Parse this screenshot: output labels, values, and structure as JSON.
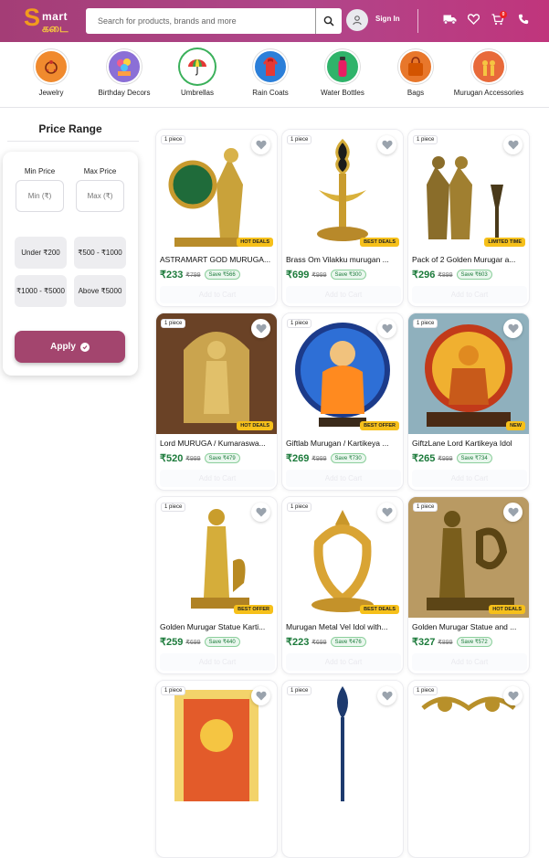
{
  "header": {
    "logo_s": "S",
    "logo_mart": "mart",
    "logo_tamil": "கடை",
    "search_placeholder": "Search for products, brands and more",
    "signin": "Sign In",
    "cart_count": "0"
  },
  "categories": [
    {
      "label": "Jewelry",
      "color": "#f08a2e"
    },
    {
      "label": "Birthday Decors",
      "color": "#8b6fd6"
    },
    {
      "label": "Umbrellas",
      "color": "#3ab05a"
    },
    {
      "label": "Rain Coats",
      "color": "#2b7fd9"
    },
    {
      "label": "Water Bottles",
      "color": "#2fb36a"
    },
    {
      "label": "Bags",
      "color": "#e8772b"
    },
    {
      "label": "Murugan Accessories",
      "color": "#e86a3a"
    }
  ],
  "filter": {
    "title": "Price Range",
    "min_label": "Min Price",
    "max_label": "Max Price",
    "min_placeholder": "Min (₹)",
    "max_placeholder": "Max (₹)",
    "ranges": [
      "Under ₹200",
      "₹500 - ₹1000",
      "₹1000 - ₹5000",
      "Above ₹5000"
    ],
    "apply": "Apply"
  },
  "products": [
    {
      "piece": "1 piece",
      "tag": "HOT DEALS",
      "name": "ASTRAMART GOD MURUGA...",
      "price": "₹233",
      "mrp": "₹799",
      "save": "Save ₹566",
      "cart": "Add to Cart",
      "bg": "#ffffff"
    },
    {
      "piece": "1 piece",
      "tag": "BEST DEALS",
      "name": "Brass Om Vilakku murugan ...",
      "price": "₹699",
      "mrp": "₹999",
      "save": "Save ₹300",
      "cart": "Add to Cart",
      "bg": "#ffffff"
    },
    {
      "piece": "1 piece",
      "tag": "LIMITED TIME",
      "name": "Pack of 2 Golden Murugar a...",
      "price": "₹296",
      "mrp": "₹899",
      "save": "Save ₹603",
      "cart": "Add to Cart",
      "bg": "#ffffff"
    },
    {
      "piece": "1 piece",
      "tag": "HOT DEALS",
      "name": "Lord MURUGA / Kumaraswa...",
      "price": "₹520",
      "mrp": "₹999",
      "save": "Save ₹479",
      "cart": "Add to Cart",
      "bg": "#6a4226"
    },
    {
      "piece": "1 piece",
      "tag": "BEST OFFER",
      "name": "Giftlab Murugan / Kartikeya ...",
      "price": "₹269",
      "mrp": "₹999",
      "save": "Save ₹730",
      "cart": "Add to Cart",
      "bg": "#ffffff"
    },
    {
      "piece": "1 piece",
      "tag": "NEW",
      "name": "GiftzLane Lord Kartikeya Idol",
      "price": "₹265",
      "mrp": "₹999",
      "save": "Save ₹734",
      "cart": "Add to Cart",
      "bg": "#8fb0bd"
    },
    {
      "piece": "1 piece",
      "tag": "BEST OFFER",
      "name": "Golden Murugar Statue Karti...",
      "price": "₹259",
      "mrp": "₹699",
      "save": "Save ₹440",
      "cart": "Add to Cart",
      "bg": "#ffffff"
    },
    {
      "piece": "1 piece",
      "tag": "BEST DEALS",
      "name": "Murugan Metal Vel Idol with...",
      "price": "₹223",
      "mrp": "₹699",
      "save": "Save ₹476",
      "cart": "Add to Cart",
      "bg": "#ffffff"
    },
    {
      "piece": "1 piece",
      "tag": "HOT DEALS",
      "name": "Golden Murugar Statue and ...",
      "price": "₹327",
      "mrp": "₹899",
      "save": "Save ₹572",
      "cart": "Add to Cart",
      "bg": "#b99a63"
    },
    {
      "piece": "1 piece",
      "tag": "",
      "name": "",
      "price": "",
      "mrp": "",
      "save": "",
      "cart": "",
      "bg": "#ffffff"
    },
    {
      "piece": "1 piece",
      "tag": "",
      "name": "",
      "price": "",
      "mrp": "",
      "save": "",
      "cart": "",
      "bg": "#ffffff"
    },
    {
      "piece": "1 piece",
      "tag": "",
      "name": "",
      "price": "",
      "mrp": "",
      "save": "",
      "cart": "",
      "bg": "#ffffff"
    }
  ],
  "colors": {
    "accent": "#a3456e",
    "price": "#1b7a3a",
    "tag": "#f6c01a"
  }
}
